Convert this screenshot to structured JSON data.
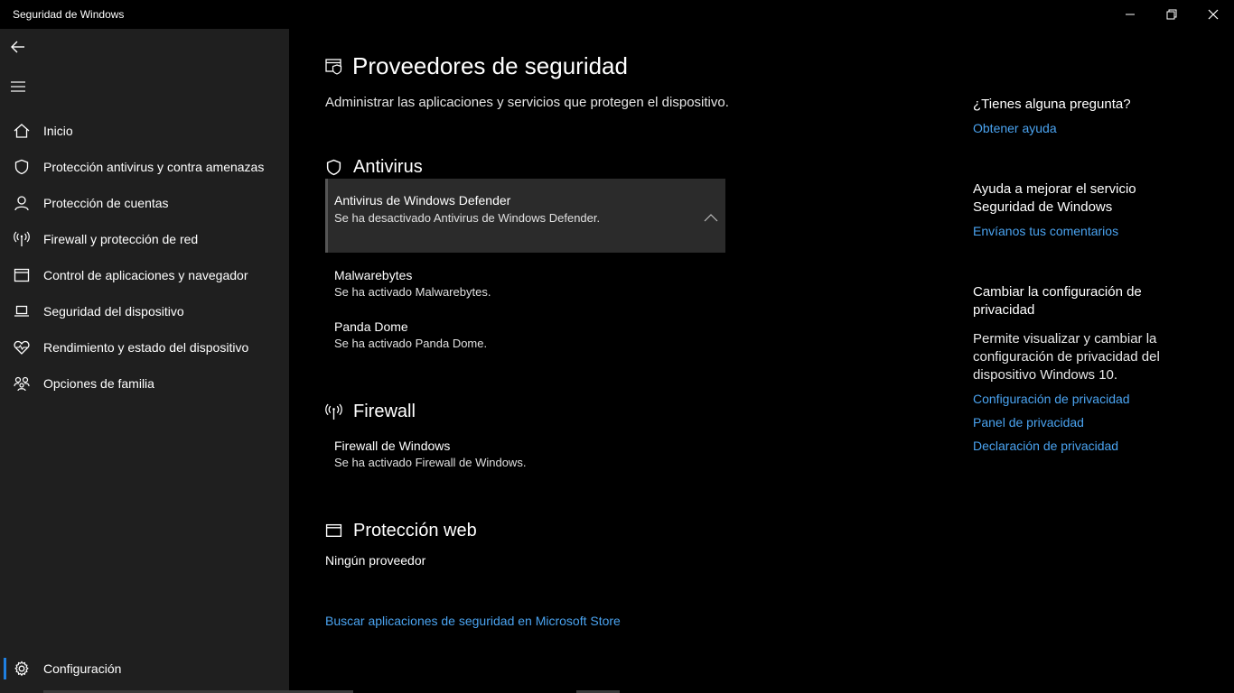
{
  "window": {
    "title": "Seguridad de Windows"
  },
  "sidebar": {
    "items": [
      {
        "label": "Inicio",
        "icon": "home-icon"
      },
      {
        "label": "Protección antivirus y contra amenazas",
        "icon": "shield-icon"
      },
      {
        "label": "Protección de cuentas",
        "icon": "person-icon"
      },
      {
        "label": "Firewall y protección de red",
        "icon": "antenna-icon"
      },
      {
        "label": "Control de aplicaciones y navegador",
        "icon": "app-browser-icon"
      },
      {
        "label": "Seguridad del dispositivo",
        "icon": "laptop-icon"
      },
      {
        "label": "Rendimiento y estado del dispositivo",
        "icon": "heart-icon"
      },
      {
        "label": "Opciones de familia",
        "icon": "family-icon"
      }
    ],
    "settings_label": "Configuración"
  },
  "main": {
    "title": "Proveedores de seguridad",
    "subtitle": "Administrar las aplicaciones y servicios que protegen el dispositivo.",
    "antivirus": {
      "heading": "Antivirus",
      "providers": [
        {
          "name": "Antivirus de Windows Defender",
          "status": "Se ha desactivado Antivirus de Windows Defender."
        },
        {
          "name": "Malwarebytes",
          "status": "Se ha activado Malwarebytes."
        },
        {
          "name": "Panda Dome",
          "status": "Se ha activado Panda Dome."
        }
      ]
    },
    "firewall": {
      "heading": "Firewall",
      "providers": [
        {
          "name": "Firewall de Windows",
          "status": "Se ha activado Firewall de Windows."
        }
      ]
    },
    "web": {
      "heading": "Protección web",
      "none_text": "Ningún proveedor"
    },
    "store_link": "Buscar aplicaciones de seguridad en Microsoft Store"
  },
  "right": {
    "question": "¿Tienes alguna pregunta?",
    "help_link": "Obtener ayuda",
    "improve_line1": "Ayuda a mejorar el servicio",
    "improve_line2": "Seguridad de Windows",
    "feedback_link": "Envíanos tus comentarios",
    "privacy_title_line1": "Cambiar la configuración de",
    "privacy_title_line2": "privacidad",
    "privacy_text_line1": "Permite visualizar y cambiar la",
    "privacy_text_line2": "configuración de privacidad del",
    "privacy_text_line3": "dispositivo Windows 10.",
    "privacy_links": [
      "Configuración de privacidad",
      "Panel de privacidad",
      "Declaración de privacidad"
    ]
  },
  "colors": {
    "accent": "#4aa3f0",
    "sidebar_bg": "#1f1f1f",
    "card_bg": "#2b2b2b"
  }
}
